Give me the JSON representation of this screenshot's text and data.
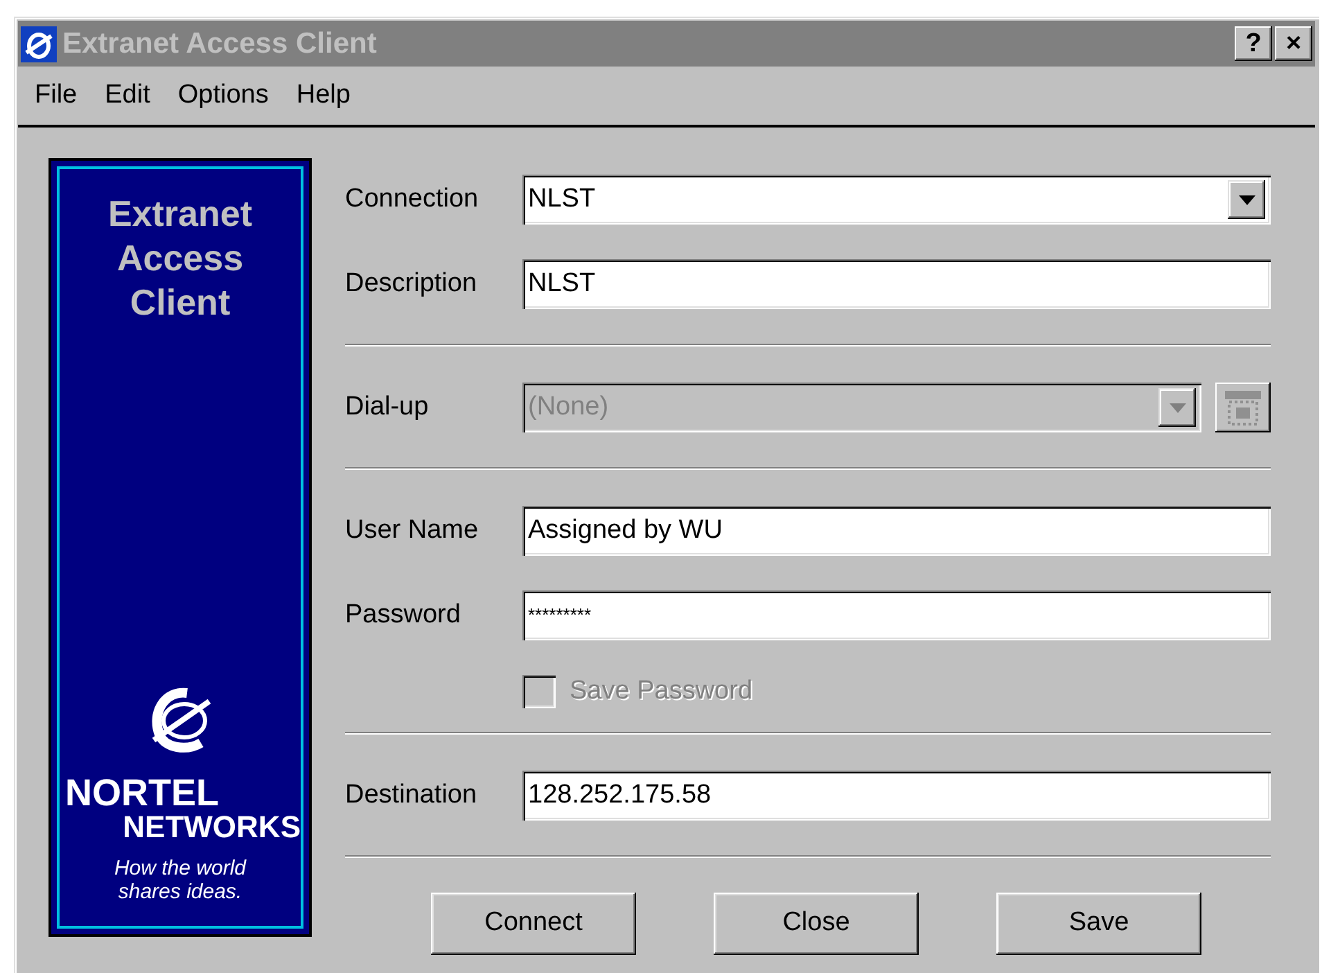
{
  "window": {
    "title": "Extranet Access Client",
    "active": false,
    "buttons": [
      "?",
      "×"
    ]
  },
  "menu": [
    "File",
    "Edit",
    "Options",
    "Help"
  ],
  "banner": {
    "title_lines": [
      "Extranet",
      "Access",
      "Client"
    ],
    "brand_lines": [
      "NORTEL",
      "NETWORKS"
    ],
    "tagline_lines": [
      "How the world",
      "shares ideas."
    ]
  },
  "sections": [
    [
      {
        "kind": "combo",
        "label": "Connection",
        "value": "NLST",
        "disabled": false
      },
      {
        "kind": "text",
        "label": "Description",
        "value": "NLST",
        "disabled": false
      }
    ],
    [
      {
        "kind": "combo",
        "label": "Dial-up",
        "value": "(None)",
        "disabled": true,
        "side_button": {
          "disabled": true
        }
      }
    ],
    [
      {
        "kind": "text",
        "label": "User Name",
        "value": "Assigned by WU",
        "disabled": false
      },
      {
        "kind": "password",
        "label": "Password",
        "value": "*********",
        "disabled": false
      },
      {
        "kind": "checkbox",
        "label": "Save Password",
        "checked": false,
        "disabled": true
      }
    ],
    [
      {
        "kind": "text",
        "label": "Destination",
        "value": "128.252.175.58",
        "disabled": false
      }
    ]
  ],
  "buttons": [
    "Connect",
    "Close",
    "Save"
  ]
}
